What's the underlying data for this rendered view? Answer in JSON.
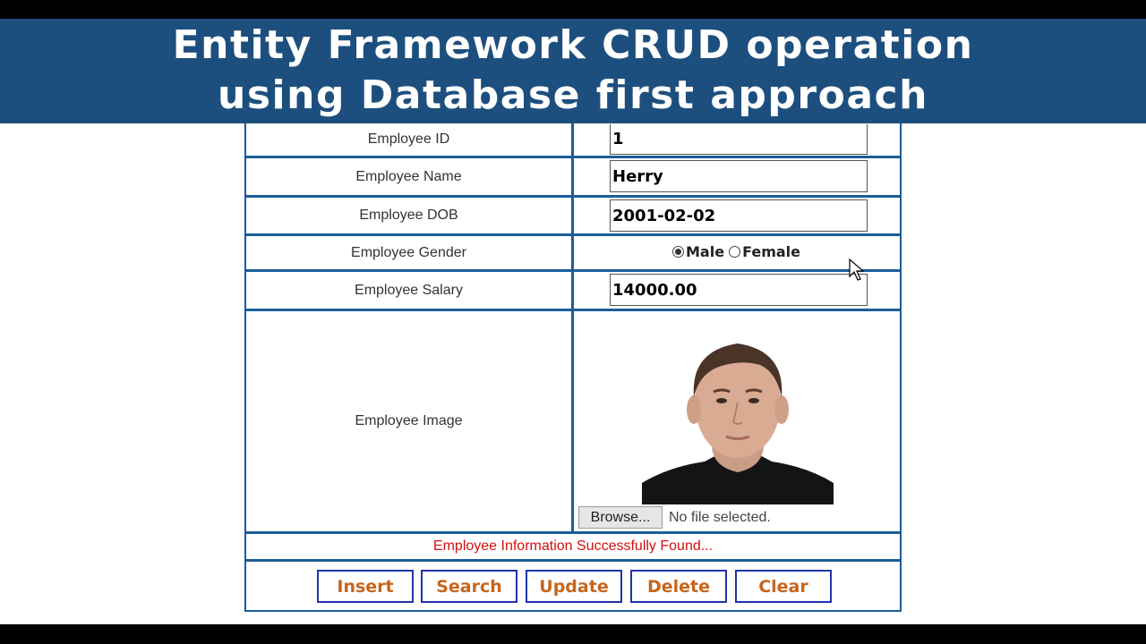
{
  "banner": {
    "line1": "Entity Framework CRUD operation",
    "line2": "using Database first approach"
  },
  "form": {
    "rows": [
      {
        "label": "Employee ID",
        "value": "1"
      },
      {
        "label": "Employee Name",
        "value": "Herry"
      },
      {
        "label": "Employee DOB",
        "value": "2001-02-02"
      },
      {
        "label": "Employee Gender",
        "options": [
          "Male",
          "Female"
        ],
        "selected": "Male"
      },
      {
        "label": "Employee Salary",
        "value": "14000.00"
      },
      {
        "label": "Employee Image",
        "browse_label": "Browse...",
        "file_status": "No file selected."
      }
    ],
    "message": "Employee Information Successfully Found...",
    "buttons": [
      "Insert",
      "Search",
      "Update",
      "Delete",
      "Clear"
    ]
  },
  "colors": {
    "banner_bg": "#1d4f7e",
    "table_border": "#1a5e99",
    "message": "#d11010",
    "button_text": "#c8651b",
    "button_border": "#2233aa"
  },
  "icons": {
    "cursor": "mouse-pointer-icon"
  }
}
